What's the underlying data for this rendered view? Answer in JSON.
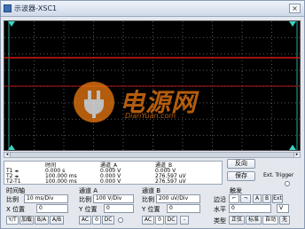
{
  "window": {
    "title": "示波器-XSC1",
    "close_label": "×"
  },
  "screen": {
    "background": "#000000",
    "grid_color": "#5a5a5a",
    "trace_a_color": "#d01818",
    "trace_b_color": "#8a1010",
    "cursor_color": "#3ad3c4"
  },
  "watermark": {
    "text": "电源网",
    "url": "DianYuan.com"
  },
  "readout": {
    "headers": {
      "time": "时间",
      "channel_a": "通道_A",
      "channel_b": "通道_B"
    },
    "rows": [
      {
        "label": "T1",
        "time": "0.000 s",
        "channel_a": "0.000 V",
        "channel_b": "0.000 V"
      },
      {
        "label": "T2",
        "time": "100.000 ms",
        "channel_a": "0.000 V",
        "channel_b": "276.597 uV"
      },
      {
        "label": "T2-T1",
        "time": "100.000 ms",
        "channel_a": "0.000 V",
        "channel_b": "276.597 uV"
      }
    ]
  },
  "buttons": {
    "reverse": "反向",
    "save": "保存",
    "ext_trigger": "Ext. Trigger"
  },
  "timebase": {
    "section": "时间轴",
    "scale_label": "比例",
    "scale_value": "10 ms/Div",
    "xpos_label": "X 位置",
    "xpos_value": "0",
    "modes": [
      "Y/T",
      "加载",
      "B/A",
      "A/B"
    ]
  },
  "channel_a": {
    "section": "通道 A",
    "scale_label": "比例",
    "scale_value": "100 V/Div",
    "ypos_label": "Y 位置",
    "ypos_value": "0",
    "coupling": [
      "AC",
      "0",
      "DC"
    ]
  },
  "channel_b": {
    "section": "通道 B",
    "scale_label": "比例",
    "scale_value": "200 uV/Div",
    "ypos_label": "Y 位置",
    "ypos_value": "0",
    "coupling": [
      "AC",
      "0",
      "DC"
    ],
    "minus": "-"
  },
  "trigger": {
    "section": "触发",
    "edge_label": "边沿",
    "level_label": "水平",
    "level_value": "0",
    "level_unit": "V",
    "type_label": "类型",
    "types": [
      "正弦",
      "标准",
      "自动",
      "无"
    ]
  }
}
